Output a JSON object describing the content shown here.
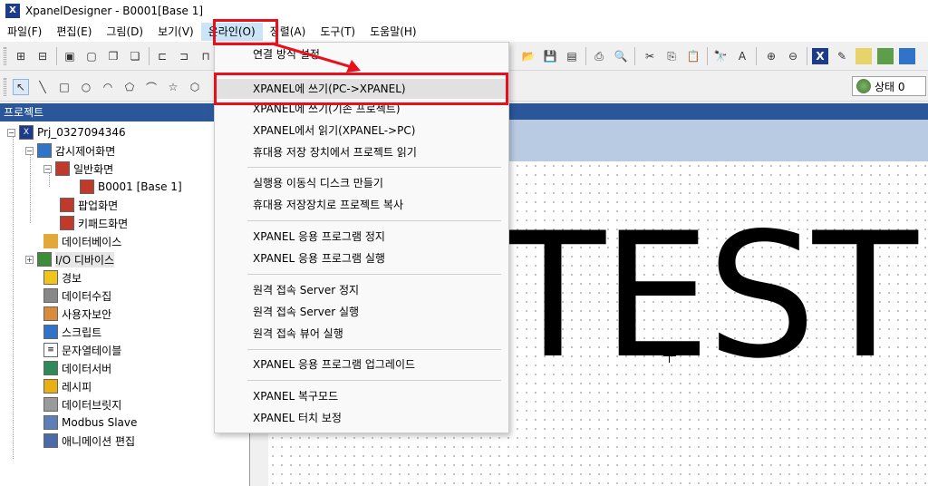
{
  "window": {
    "title": "XpanelDesigner - B0001[Base 1]"
  },
  "menubar": {
    "items": [
      "파일(F)",
      "편집(E)",
      "그림(D)",
      "보기(V)",
      "온라인(O)",
      "정렬(A)",
      "도구(T)",
      "도움말(H)"
    ]
  },
  "toolbar": {
    "status_label": "상태 0"
  },
  "project_panel": {
    "title": "프로젝트",
    "tree": [
      {
        "label": "Prj_0327094346",
        "icon": "project-icon"
      },
      {
        "label": "감시제어화면",
        "icon": "monitor-icon"
      },
      {
        "label": "일반화면",
        "icon": "screen-folder-icon"
      },
      {
        "label": "B0001 [Base 1]",
        "icon": "screen-icon"
      },
      {
        "label": "팝업화면",
        "icon": "popup-screen-icon"
      },
      {
        "label": "키패드화면",
        "icon": "keypad-screen-icon"
      },
      {
        "label": "데이터베이스",
        "icon": "database-icon"
      },
      {
        "label": "I/O 디바이스",
        "icon": "io-device-icon"
      },
      {
        "label": "경보",
        "icon": "alarm-icon"
      },
      {
        "label": "데이터수집",
        "icon": "data-collect-icon"
      },
      {
        "label": "사용자보안",
        "icon": "user-security-icon"
      },
      {
        "label": "스크립트",
        "icon": "script-icon"
      },
      {
        "label": "문자열테이블",
        "icon": "string-table-icon"
      },
      {
        "label": "데이터서버",
        "icon": "data-server-icon"
      },
      {
        "label": "레시피",
        "icon": "recipe-icon"
      },
      {
        "label": "데이터브릿지",
        "icon": "data-bridge-icon"
      },
      {
        "label": "Modbus Slave",
        "icon": "modbus-icon"
      },
      {
        "label": "애니메이션 편집",
        "icon": "animation-icon"
      }
    ]
  },
  "dropdown": {
    "items": [
      "연결 방식 설정",
      "XPANEL에 쓰기(PC->XPANEL)",
      "XPANEL에 쓰기(기존 프로젝트)",
      "XPANEL에서 읽기(XPANEL->PC)",
      "휴대용 저장 장치에서 프로젝트 읽기",
      "실행용 이동식 디스크 만들기",
      "휴대용 저장장치로 프로젝트 복사",
      "XPANEL 응용 프로그램 정지",
      "XPANEL 응용 프로그램 실행",
      "원격 접속 Server 정지",
      "원격 접속 Server 실행",
      "원격 접속 뷰어 실행",
      "XPANEL 응용 프로그램 업그레이드",
      "XPANEL 복구모드",
      "XPANEL 터치 보정"
    ]
  },
  "canvas": {
    "text": "TEST"
  },
  "colors": {
    "annotation_red": "#e8101a",
    "panel_header": "#2b579a"
  }
}
